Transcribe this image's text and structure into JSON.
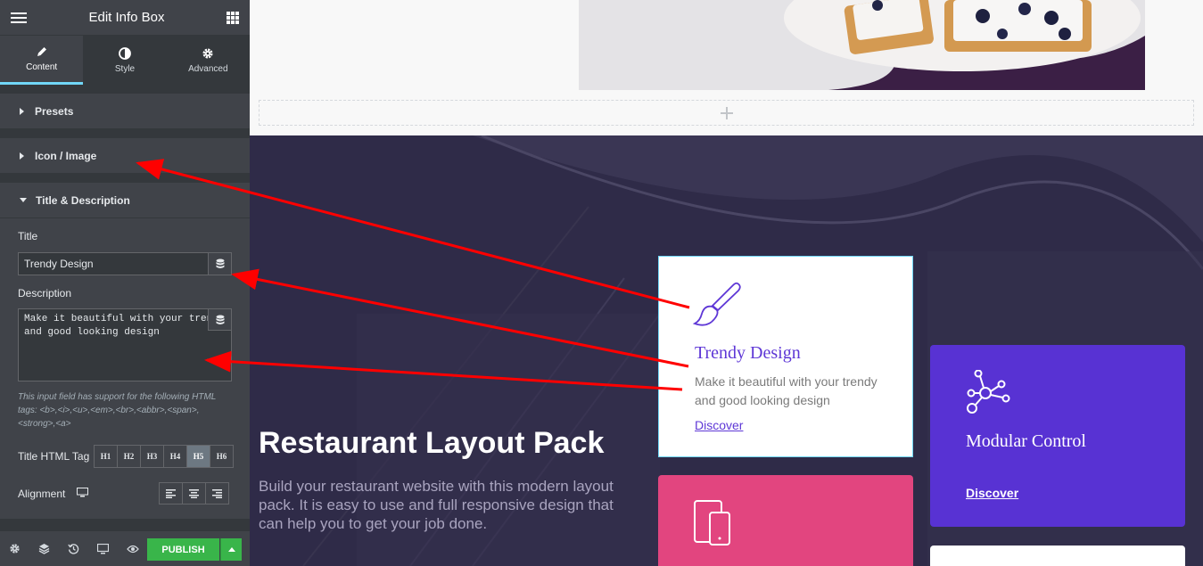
{
  "panel": {
    "header_title": "Edit Info Box",
    "tabs": [
      {
        "label": "Content",
        "icon": "pencil-icon",
        "active": true
      },
      {
        "label": "Style",
        "icon": "contrast-icon",
        "active": false
      },
      {
        "label": "Advanced",
        "icon": "gear-icon",
        "active": false
      }
    ],
    "sections": {
      "presets": "Presets",
      "icon_image": "Icon / Image",
      "title_description": "Title & Description"
    },
    "title_label": "Title",
    "title_value": "Trendy Design",
    "description_label": "Description",
    "description_value": "Make it beautiful with your trendy\nand good looking design",
    "html_note": "This input field has support for the following HTML tags: <b>,<i>,<u>,<em>,<br>,<abbr>,<span>,<strong>,<a>",
    "title_html_tag_label": "Title HTML Tag",
    "html_tags": [
      "H1",
      "H2",
      "H3",
      "H4",
      "H5",
      "H6"
    ],
    "selected_tag": "H5",
    "alignment_label": "Alignment",
    "publish_label": "PUBLISH",
    "accent_color": "#71d7f7",
    "publish_color": "#39b54a"
  },
  "preview": {
    "hero_title": "Restaurant Layout Pack",
    "hero_description": "Build your restaurant website with this modern layout pack. It is easy to use and full responsive design that can help you to get your job done.",
    "cards": {
      "trendy": {
        "title": "Trendy Design",
        "description": "Make it beautiful with your trendy and good looking design",
        "link": "Discover",
        "icon": "paintbrush-icon"
      },
      "modular": {
        "title": "Modular Control",
        "link": "Discover",
        "icon": "network-icon",
        "color": "#5832d3"
      },
      "pink": {
        "icon": "devices-icon",
        "color": "#e2457f"
      }
    },
    "brand_color": "#5e37d6",
    "annotation_color": "#ff0000"
  }
}
